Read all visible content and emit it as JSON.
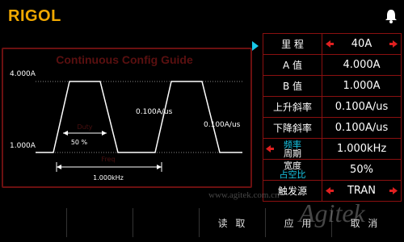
{
  "header": {
    "brand": "RIGOL"
  },
  "graph": {
    "title": "Continuous Config Guide",
    "level_high": "4.000A",
    "level_low": "1.000A",
    "slope_up": "0.100A/us",
    "slope_down": "0.100A/us",
    "duty_label": "Duty",
    "duty_value": "50 %",
    "period_label": "Freq",
    "freq_value": "1.000kHz"
  },
  "params": [
    {
      "name": "里 程",
      "value": "40A",
      "selectable": true
    },
    {
      "name": "A 值",
      "value": "4.000A"
    },
    {
      "name": "B 值",
      "value": "1.000A"
    },
    {
      "name": "上升斜率",
      "value": "0.100A/us"
    },
    {
      "name": "下降斜率",
      "value": "0.100A/us"
    },
    {
      "name_top": "频率",
      "name_bottom": "周期",
      "value": "1.000kHz",
      "selectable_left": true
    },
    {
      "name_top": "宽度",
      "name_bottom": "占空比",
      "value": "50%"
    },
    {
      "name": "触发源",
      "value": "TRAN",
      "selectable": true
    }
  ],
  "softkeys": [
    "",
    "",
    "",
    "读 取",
    "应 用",
    "取 消"
  ],
  "watermark": {
    "brand": "Agitek",
    "site": "www.agitek.com.cn"
  },
  "colors": {
    "accent": "#f0a800",
    "border": "#8a1010",
    "arrow": "#e02020",
    "cyan": "#18c8e8"
  }
}
